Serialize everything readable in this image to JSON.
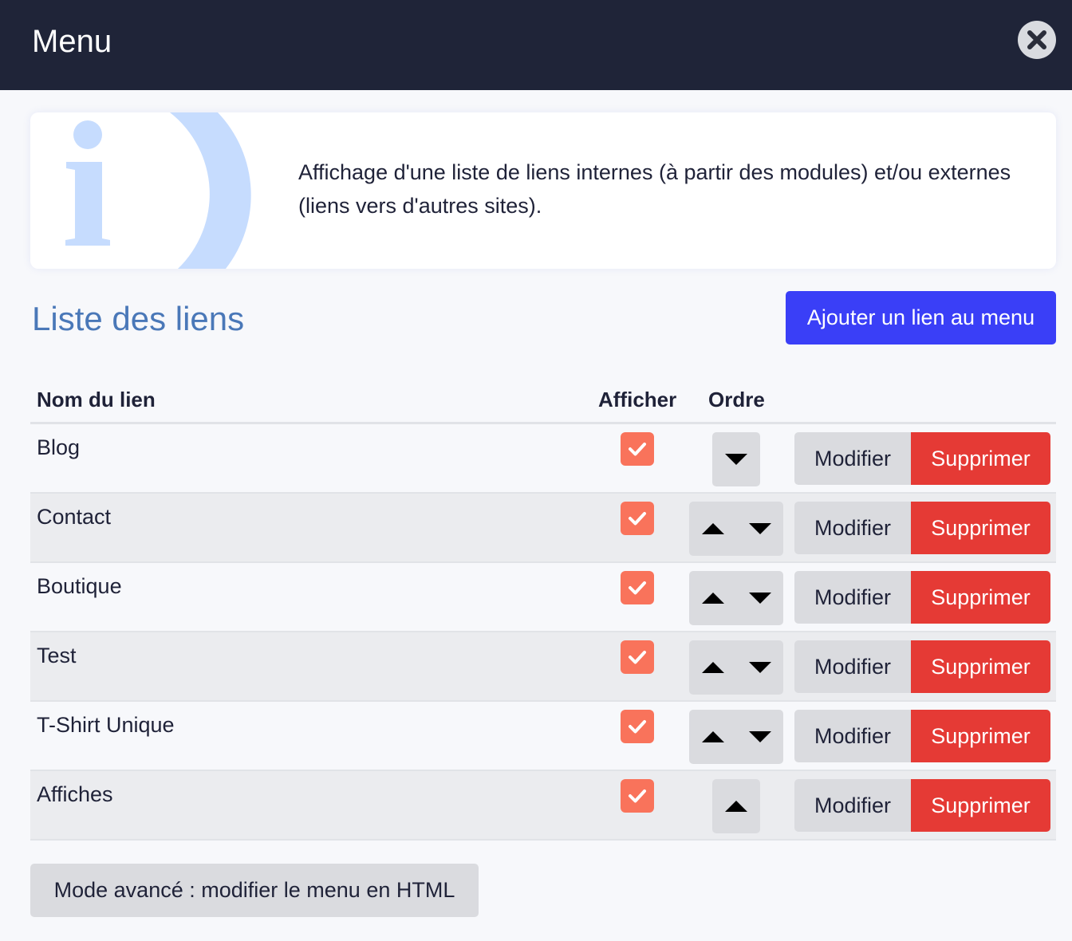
{
  "header": {
    "title": "Menu",
    "close_icon": "close-icon"
  },
  "info": {
    "icon": "info-icon",
    "text": "Affichage d'une liste de liens internes (à partir des modules) et/ou externes (liens vers d'autres sites)."
  },
  "section": {
    "title": "Liste des liens",
    "add_button": "Ajouter un lien au menu"
  },
  "table": {
    "headers": {
      "name": "Nom du lien",
      "show": "Afficher",
      "order": "Ordre"
    },
    "rows": [
      {
        "name": "Blog",
        "show": true,
        "up": false,
        "down": true
      },
      {
        "name": "Contact",
        "show": true,
        "up": true,
        "down": true
      },
      {
        "name": "Boutique",
        "show": true,
        "up": true,
        "down": true
      },
      {
        "name": "Test",
        "show": true,
        "up": true,
        "down": true
      },
      {
        "name": "T-Shirt Unique",
        "show": true,
        "up": true,
        "down": true
      },
      {
        "name": "Affiches",
        "show": true,
        "up": true,
        "down": false
      }
    ],
    "edit_label": "Modifier",
    "delete_label": "Supprimer"
  },
  "advanced_button": "Mode avancé : modifier le menu en HTML",
  "colors": {
    "header_bg": "#1f2438",
    "accent_blue": "#3a3ff7",
    "title_blue": "#4a78b8",
    "checkbox": "#f9735b",
    "delete_red": "#e53a35"
  }
}
